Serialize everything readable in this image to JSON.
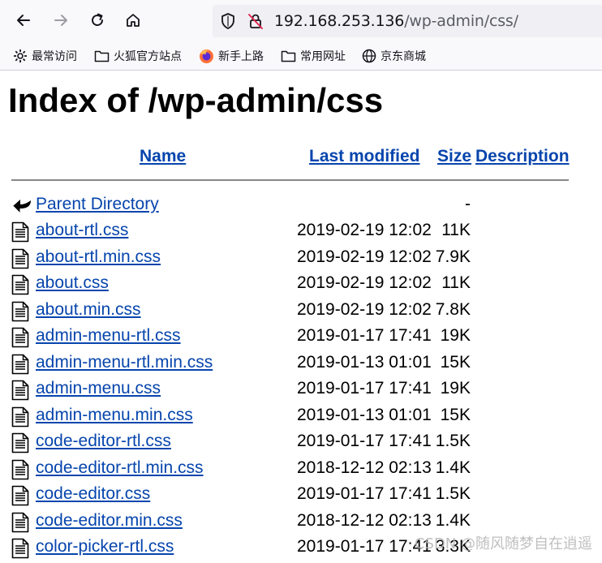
{
  "browser": {
    "url_host": "192.168.253.136",
    "url_path": "/wp-admin/css/",
    "bookmarks": [
      {
        "label": "最常访问",
        "icon": "gear-icon"
      },
      {
        "label": "火狐官方站点",
        "icon": "folder-icon"
      },
      {
        "label": "新手上路",
        "icon": "firefox-icon"
      },
      {
        "label": "常用网址",
        "icon": "folder-icon"
      },
      {
        "label": "京东商城",
        "icon": "globe-icon"
      }
    ]
  },
  "page": {
    "title": "Index of /wp-admin/css",
    "columns": {
      "name": "Name",
      "last_modified": "Last modified",
      "size": "Size",
      "description": "Description"
    },
    "rows": [
      {
        "name": "Parent Directory",
        "date": "",
        "size": "-",
        "icon": "back-arrow-icon"
      },
      {
        "name": "about-rtl.css",
        "date": "2019-02-19 12:02",
        "size": "11K",
        "icon": "file-icon"
      },
      {
        "name": "about-rtl.min.css",
        "date": "2019-02-19 12:02",
        "size": "7.9K",
        "icon": "file-icon"
      },
      {
        "name": "about.css",
        "date": "2019-02-19 12:02",
        "size": "11K",
        "icon": "file-icon"
      },
      {
        "name": "about.min.css",
        "date": "2019-02-19 12:02",
        "size": "7.8K",
        "icon": "file-icon"
      },
      {
        "name": "admin-menu-rtl.css",
        "date": "2019-01-17 17:41",
        "size": "19K",
        "icon": "file-icon"
      },
      {
        "name": "admin-menu-rtl.min.css",
        "date": "2019-01-13 01:01",
        "size": "15K",
        "icon": "file-icon"
      },
      {
        "name": "admin-menu.css",
        "date": "2019-01-17 17:41",
        "size": "19K",
        "icon": "file-icon"
      },
      {
        "name": "admin-menu.min.css",
        "date": "2019-01-13 01:01",
        "size": "15K",
        "icon": "file-icon"
      },
      {
        "name": "code-editor-rtl.css",
        "date": "2019-01-17 17:41",
        "size": "1.5K",
        "icon": "file-icon"
      },
      {
        "name": "code-editor-rtl.min.css",
        "date": "2018-12-12 02:13",
        "size": "1.4K",
        "icon": "file-icon"
      },
      {
        "name": "code-editor.css",
        "date": "2019-01-17 17:41",
        "size": "1.5K",
        "icon": "file-icon"
      },
      {
        "name": "code-editor.min.css",
        "date": "2018-12-12 02:13",
        "size": "1.4K",
        "icon": "file-icon"
      },
      {
        "name": "color-picker-rtl.css",
        "date": "2019-01-17 17:41",
        "size": "3.3K",
        "icon": "file-icon"
      }
    ]
  },
  "watermark": "CSDN @随风随梦自在逍遥",
  "colors": {
    "link": "#0645ad",
    "toolbar": "#f9f9fb",
    "urlbar": "#f0f0f4"
  }
}
